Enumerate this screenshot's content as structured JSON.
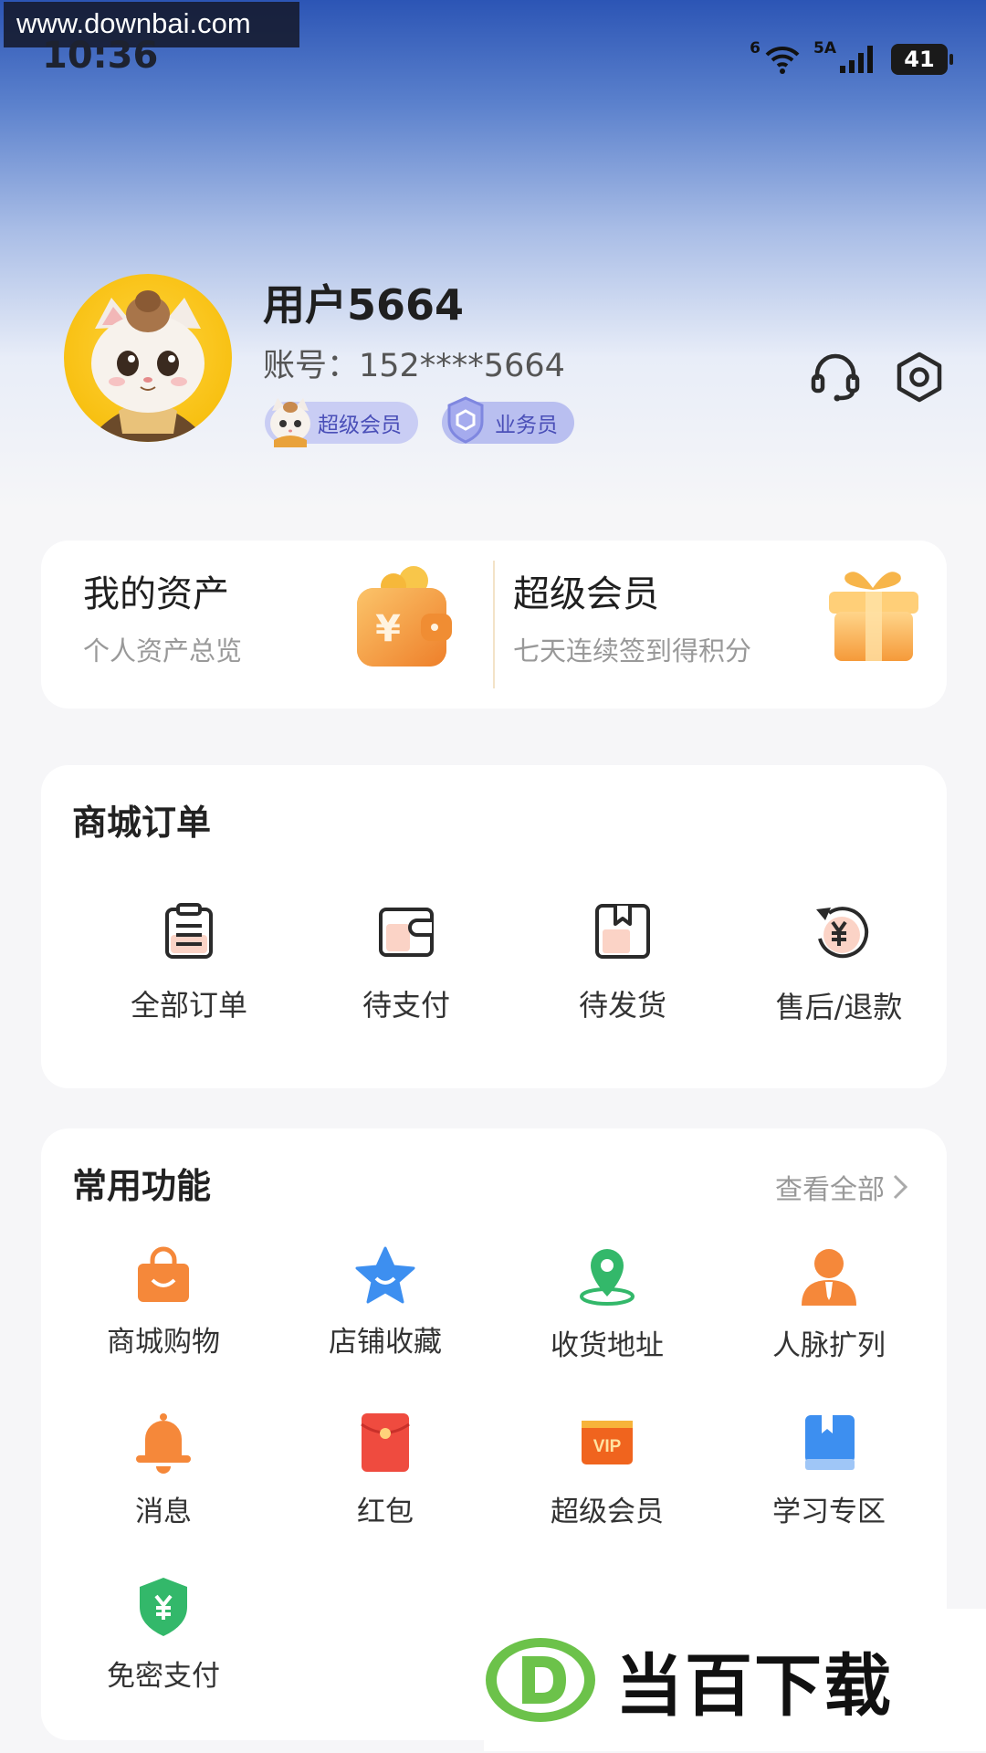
{
  "watermark_top": "www.downbai.com",
  "status": {
    "time": "10:36",
    "wifi_label": "6",
    "signal_label": "5A",
    "battery": "41"
  },
  "profile": {
    "username": "用户5664",
    "account": "账号：152****5664",
    "badges": [
      "超级会员",
      "业务员"
    ]
  },
  "assets": [
    {
      "title": "我的资产",
      "subtitle": "个人资产总览",
      "icon": "wallet-icon"
    },
    {
      "title": "超级会员",
      "subtitle": "七天连续签到得积分",
      "icon": "gift-box-icon"
    }
  ],
  "orders": {
    "title": "商城订单",
    "items": [
      "全部订单",
      "待支付",
      "待发货",
      "售后/退款"
    ]
  },
  "functions": {
    "title": "常用功能",
    "view_all": "查看全部",
    "items": [
      "商城购物",
      "店铺收藏",
      "收货地址",
      "人脉扩列",
      "消息",
      "红包",
      "超级会员",
      "学习专区",
      "免密支付"
    ]
  },
  "watermark_bottom": "当百下载",
  "colors": {
    "accent_orange": "#f5883a",
    "accent_blue": "#3d8ff0",
    "accent_green": "#33b86a",
    "accent_red": "#ef4b3f",
    "badge_purple": "#c9cdf4"
  }
}
